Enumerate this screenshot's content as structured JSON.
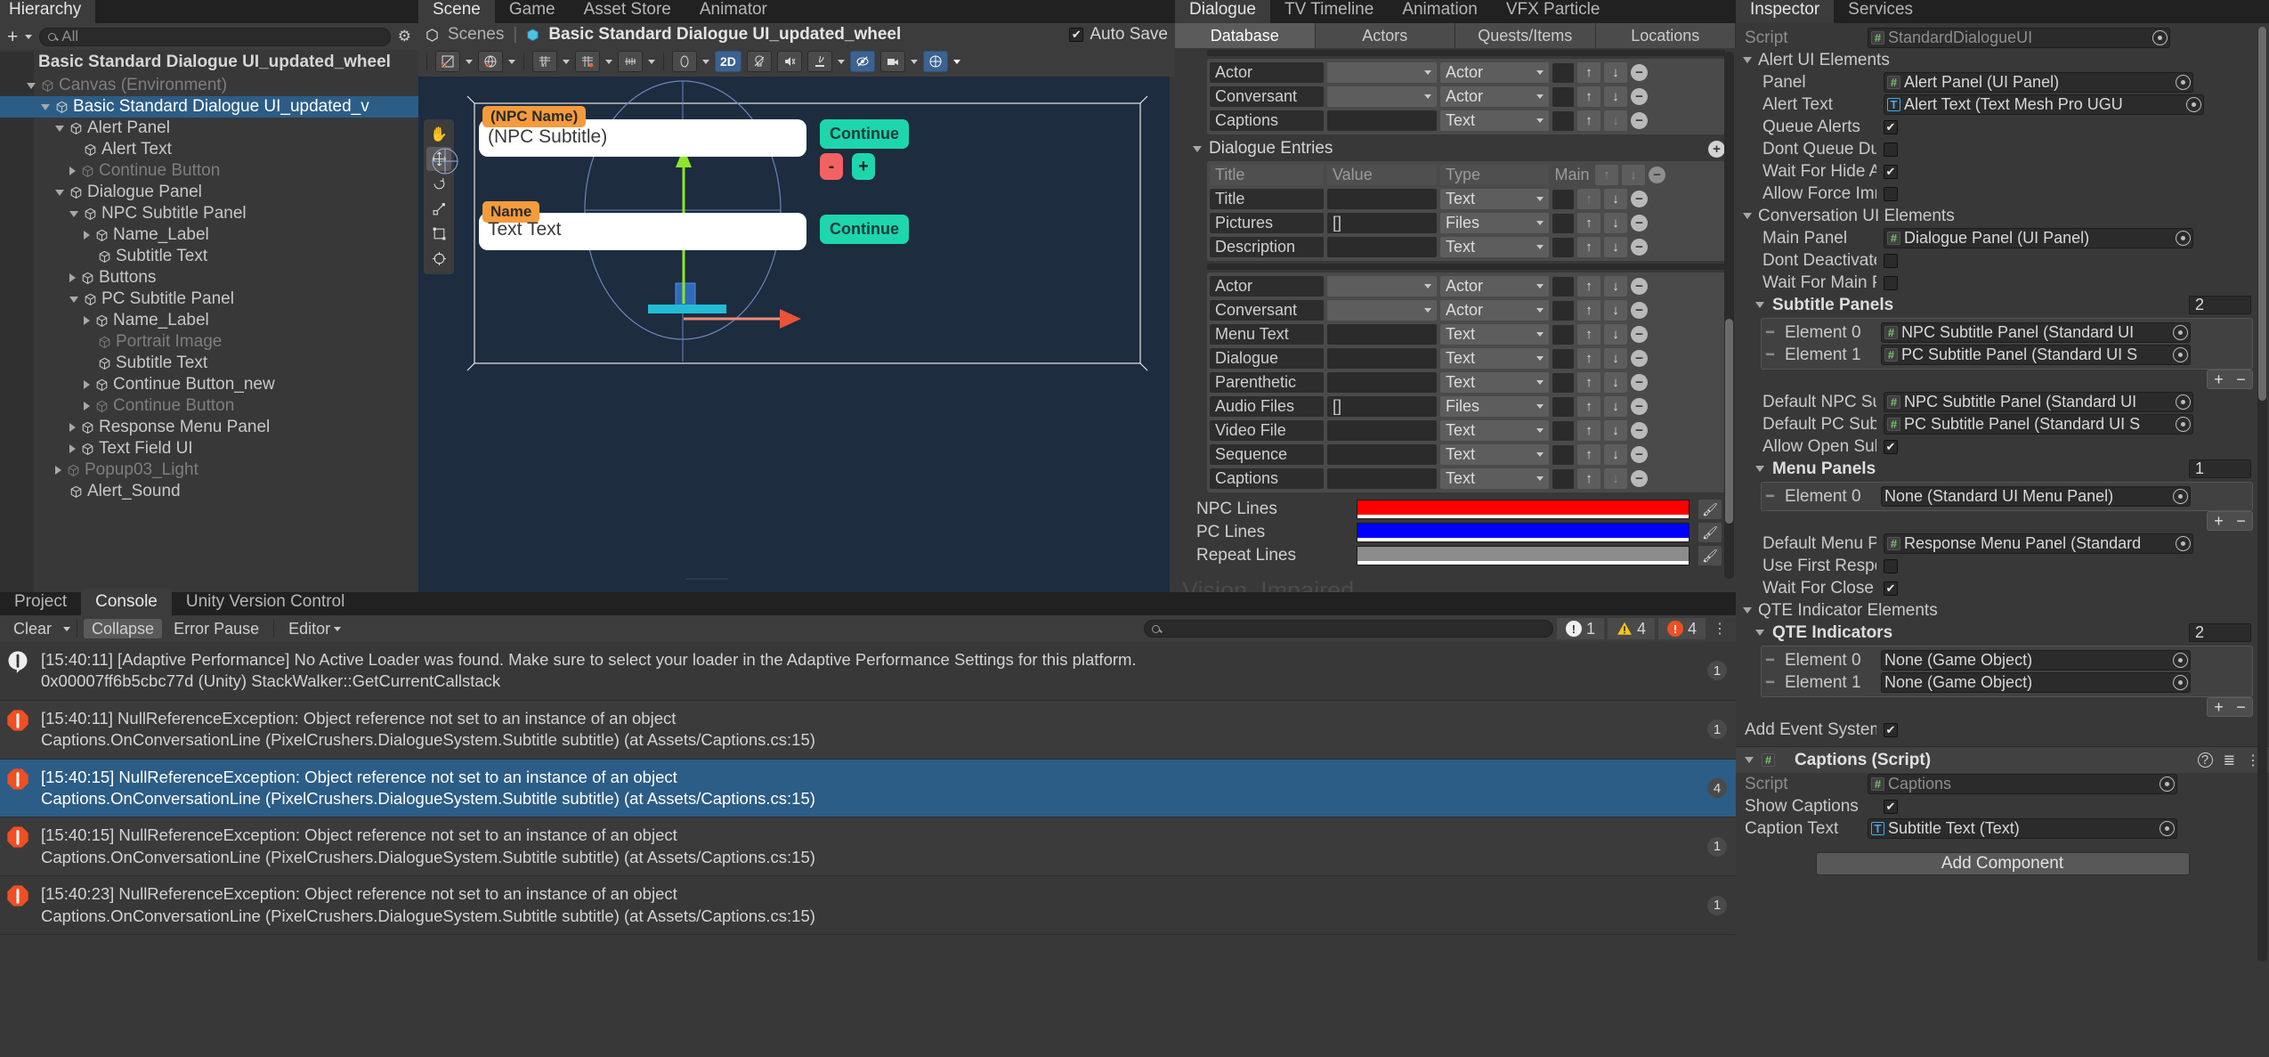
{
  "hierarchy": {
    "search_placeholder": "All",
    "title_tab": "Hierarchy",
    "scene_root": "Basic Standard Dialogue UI_updated_wheel",
    "rows": [
      {
        "label": "Canvas (Environment)",
        "depth": 1,
        "tri": "down",
        "state": "dim"
      },
      {
        "label": "Basic Standard Dialogue UI_updated_v",
        "depth": 2,
        "tri": "down",
        "state": "sel"
      },
      {
        "label": "Alert Panel",
        "depth": 3,
        "tri": "down",
        "state": "normal"
      },
      {
        "label": "Alert Text",
        "depth": 4,
        "tri": "none",
        "state": "normal"
      },
      {
        "label": "Continue Button",
        "depth": 4,
        "tri": "right",
        "state": "dim"
      },
      {
        "label": "Dialogue Panel",
        "depth": 3,
        "tri": "down",
        "state": "normal"
      },
      {
        "label": "NPC Subtitle Panel",
        "depth": 4,
        "tri": "down",
        "state": "normal"
      },
      {
        "label": "Name_Label",
        "depth": 5,
        "tri": "right",
        "state": "normal"
      },
      {
        "label": "Subtitle Text",
        "depth": 5,
        "tri": "none",
        "state": "normal"
      },
      {
        "label": "Buttons",
        "depth": 4,
        "tri": "right",
        "state": "normal"
      },
      {
        "label": "PC Subtitle Panel",
        "depth": 4,
        "tri": "down",
        "state": "normal"
      },
      {
        "label": "Name_Label",
        "depth": 5,
        "tri": "right",
        "state": "normal"
      },
      {
        "label": "Portrait Image",
        "depth": 5,
        "tri": "none",
        "state": "dim"
      },
      {
        "label": "Subtitle Text",
        "depth": 5,
        "tri": "none",
        "state": "normal"
      },
      {
        "label": "Continue Button_new",
        "depth": 5,
        "tri": "right",
        "state": "normal"
      },
      {
        "label": "Continue Button",
        "depth": 5,
        "tri": "right",
        "state": "dim"
      },
      {
        "label": "Response Menu Panel",
        "depth": 4,
        "tri": "right",
        "state": "normal"
      },
      {
        "label": "Text Field UI",
        "depth": 4,
        "tri": "right",
        "state": "normal"
      },
      {
        "label": "Popup03_Light",
        "depth": 3,
        "tri": "right",
        "state": "dim"
      },
      {
        "label": "Alert_Sound",
        "depth": 3,
        "tri": "none",
        "state": "normal"
      }
    ]
  },
  "scene": {
    "tabs": [
      {
        "label": "Scene",
        "active": true
      },
      {
        "label": "Game",
        "active": false
      },
      {
        "label": "Asset Store",
        "active": false
      },
      {
        "label": "Animator",
        "active": false
      }
    ],
    "breadcrumb_scenes": "Scenes",
    "breadcrumb_current": "Basic Standard Dialogue UI_updated_wheel",
    "auto_save_label": "Auto Save",
    "auto_save_checked": "✔",
    "mode_2d_label": "2D",
    "gizmo_tools": [
      "hand-tool",
      "move-tool",
      "rotate-tool",
      "scale-tool",
      "rect-tool",
      "transform-tool"
    ],
    "npc_name": "(NPC Name)",
    "npc_subtitle": "(NPC Subtitle)",
    "pc_name": "Name",
    "pc_subtitle": "Text Text",
    "continue_label": "Continue",
    "minus_label": "-",
    "plus_label": "+"
  },
  "dialogue_editor": {
    "tabs_top": [
      {
        "label": "Dialogue",
        "active": true
      },
      {
        "label": "TV Timeline",
        "active": false
      },
      {
        "label": "Animation",
        "active": false
      },
      {
        "label": "VFX Particle",
        "active": false
      }
    ],
    "tabs": [
      {
        "label": "Database",
        "active": true
      },
      {
        "label": "Actors",
        "active": false
      },
      {
        "label": "Quests/Items",
        "active": false
      },
      {
        "label": "Locations",
        "active": false
      }
    ],
    "group_a": [
      {
        "name": "Actor",
        "value": "",
        "type": "Actor",
        "valuekind": "drop",
        "up": true,
        "down": true
      },
      {
        "name": "Conversant",
        "value": "",
        "type": "Actor",
        "valuekind": "drop",
        "up": true,
        "down": true
      },
      {
        "name": "Captions",
        "value": "",
        "type": "Text",
        "valuekind": "text",
        "up": true,
        "down": false
      }
    ],
    "entries_title": "Dialogue Entries",
    "entries_header": {
      "title": "Title",
      "value": "Value",
      "type": "Type",
      "main": "Main"
    },
    "group_b": [
      {
        "name": "Title",
        "value": "",
        "type": "Text",
        "valuekind": "text",
        "up": false,
        "down": true
      },
      {
        "name": "Pictures",
        "value": "[]",
        "type": "Files",
        "valuekind": "text",
        "up": true,
        "down": true
      },
      {
        "name": "Description",
        "value": "",
        "type": "Text",
        "valuekind": "text",
        "up": true,
        "down": true
      }
    ],
    "group_c": [
      {
        "name": "Actor",
        "value": "",
        "type": "Actor",
        "valuekind": "drop",
        "up": true,
        "down": true
      },
      {
        "name": "Conversant",
        "value": "",
        "type": "Actor",
        "valuekind": "drop",
        "up": true,
        "down": true
      },
      {
        "name": "Menu Text",
        "value": "",
        "type": "Text",
        "valuekind": "text",
        "up": true,
        "down": true
      },
      {
        "name": "Dialogue",
        "value": "",
        "type": "Text",
        "valuekind": "text",
        "up": true,
        "down": true
      },
      {
        "name": "Parenthetic",
        "value": "",
        "type": "Text",
        "valuekind": "text",
        "up": true,
        "down": true
      },
      {
        "name": "Audio Files",
        "value": "[]",
        "type": "Files",
        "valuekind": "text",
        "up": true,
        "down": true
      },
      {
        "name": "Video File",
        "value": "",
        "type": "Text",
        "valuekind": "text",
        "up": true,
        "down": true
      },
      {
        "name": "Sequence",
        "value": "",
        "type": "Text",
        "valuekind": "text",
        "up": true,
        "down": true
      },
      {
        "name": "Captions",
        "value": "",
        "type": "Text",
        "valuekind": "text",
        "up": true,
        "down": false
      }
    ],
    "colors": [
      {
        "label": "NPC Lines",
        "hex": "#FF0000"
      },
      {
        "label": "PC Lines",
        "hex": "#0000FF"
      },
      {
        "label": "Repeat Lines",
        "hex": "#8C8C8C"
      }
    ],
    "ghost_text": "Vision_Impaired"
  },
  "console": {
    "tabs": [
      {
        "label": "Project",
        "active": false
      },
      {
        "label": "Console",
        "active": true
      },
      {
        "label": "Unity Version Control",
        "active": false
      }
    ],
    "toolbar": {
      "clear": "Clear",
      "collapse": "Collapse",
      "error_pause": "Error Pause",
      "editor": "Editor"
    },
    "counts": {
      "info": "1",
      "warning": "4",
      "error": "4"
    },
    "rows": [
      {
        "icon": "info",
        "selected": false,
        "line1": "[15:40:11] [Adaptive Performance] No Active Loader was found. Make sure to select your loader in the Adaptive Performance Settings for this platform.",
        "line2": "0x00007ff6b5cbc77d (Unity) StackWalker::GetCurrentCallstack",
        "count": "1"
      },
      {
        "icon": "error",
        "selected": false,
        "line1": "[15:40:11] NullReferenceException: Object reference not set to an instance of an object",
        "line2": "Captions.OnConversationLine (PixelCrushers.DialogueSystem.Subtitle subtitle) (at Assets/Captions.cs:15)",
        "count": "1"
      },
      {
        "icon": "error",
        "selected": true,
        "line1": "[15:40:15] NullReferenceException: Object reference not set to an instance of an object",
        "line2": "Captions.OnConversationLine (PixelCrushers.DialogueSystem.Subtitle subtitle) (at Assets/Captions.cs:15)",
        "count": "4"
      },
      {
        "icon": "error",
        "selected": false,
        "line1": "[15:40:15] NullReferenceException: Object reference not set to an instance of an object",
        "line2": "Captions.OnConversationLine (PixelCrushers.DialogueSystem.Subtitle subtitle) (at Assets/Captions.cs:15)",
        "count": "1"
      },
      {
        "icon": "error",
        "selected": false,
        "line1": "[15:40:23] NullReferenceException: Object reference not set to an instance of an object",
        "line2": "Captions.OnConversationLine (PixelCrushers.DialogueSystem.Subtitle subtitle) (at Assets/Captions.cs:15)",
        "count": "1"
      }
    ]
  },
  "inspector": {
    "tabs": [
      {
        "label": "Inspector",
        "active": true
      },
      {
        "label": "Services",
        "active": false
      }
    ],
    "script_label": "Script",
    "script_value": "StandardDialogueUI",
    "sections": [
      {
        "type": "foldout",
        "label": "Alert UI Elements",
        "bold": false,
        "rows": [
          {
            "kind": "object",
            "label": "Panel",
            "value": "Alert Panel (UI Panel)",
            "icon": "script"
          },
          {
            "kind": "object",
            "label": "Alert Text",
            "value": "Alert Text (Text Mesh Pro UGU",
            "icon": "tmp",
            "wide": true
          },
          {
            "kind": "check",
            "label": "Queue Alerts",
            "checked": true
          },
          {
            "kind": "check",
            "label": "Dont Queue Duplicate",
            "checked": false
          },
          {
            "kind": "check",
            "label": "Wait For Hide Animati",
            "checked": true
          },
          {
            "kind": "check",
            "label": "Allow Force Immediat",
            "checked": false
          }
        ]
      },
      {
        "type": "foldout",
        "label": "Conversation UI Elements",
        "bold": false,
        "rows": [
          {
            "kind": "object",
            "label": "Main Panel",
            "value": "Dialogue Panel (UI Panel)",
            "icon": "script"
          },
          {
            "kind": "check",
            "label": "Dont Deactivate Main",
            "checked": false
          },
          {
            "kind": "check",
            "label": "Wait For Main Panel C",
            "checked": false
          },
          {
            "kind": "array",
            "label": "Subtitle Panels",
            "size": "2",
            "elements": [
              {
                "label": "Element 0",
                "value": "NPC Subtitle Panel (Standard UI",
                "icon": "script"
              },
              {
                "label": "Element 1",
                "value": "PC Subtitle Panel (Standard UI S",
                "icon": "script"
              }
            ]
          },
          {
            "kind": "object",
            "label": "Default NPC Subtitle F",
            "value": "NPC Subtitle Panel (Standard UI",
            "icon": "script"
          },
          {
            "kind": "object",
            "label": "Default PC Subtitle Pa",
            "value": "PC Subtitle Panel (Standard UI S",
            "icon": "script"
          },
          {
            "kind": "check",
            "label": "Allow Open Subtitle P",
            "checked": true
          },
          {
            "kind": "array",
            "label": "Menu Panels",
            "size": "1",
            "elements": [
              {
                "label": "Element 0",
                "value": "None (Standard UI Menu Panel)",
                "icon": "none"
              }
            ]
          },
          {
            "kind": "object",
            "label": "Default Menu Panel",
            "value": "Response Menu Panel (Standard",
            "icon": "script"
          },
          {
            "kind": "check",
            "label": "Use First Response Fo",
            "checked": false
          },
          {
            "kind": "check",
            "label": "Wait For Close",
            "checked": true
          }
        ]
      },
      {
        "type": "foldout",
        "label": "QTE Indicator Elements",
        "bold": false,
        "rows": [
          {
            "kind": "array",
            "label": "QTE Indicators",
            "size": "2",
            "elements": [
              {
                "label": "Element 0",
                "value": "None (Game Object)",
                "icon": "none"
              },
              {
                "label": "Element 1",
                "value": "None (Game Object)",
                "icon": "none"
              }
            ]
          },
          {
            "kind": "check",
            "label": "Add Event System If Nee",
            "checked": true,
            "noindent": true
          }
        ]
      }
    ],
    "component": {
      "title": "Captions (Script)",
      "rows": [
        {
          "kind": "object",
          "label": "Script",
          "value": "Captions",
          "icon": "script",
          "dim": true
        },
        {
          "kind": "check",
          "label": "Show Captions",
          "checked": true
        },
        {
          "kind": "object",
          "label": "Caption Text",
          "value": "Subtitle Text (Text)",
          "icon": "tmp"
        }
      ]
    },
    "add_component_label": "Add Component"
  }
}
